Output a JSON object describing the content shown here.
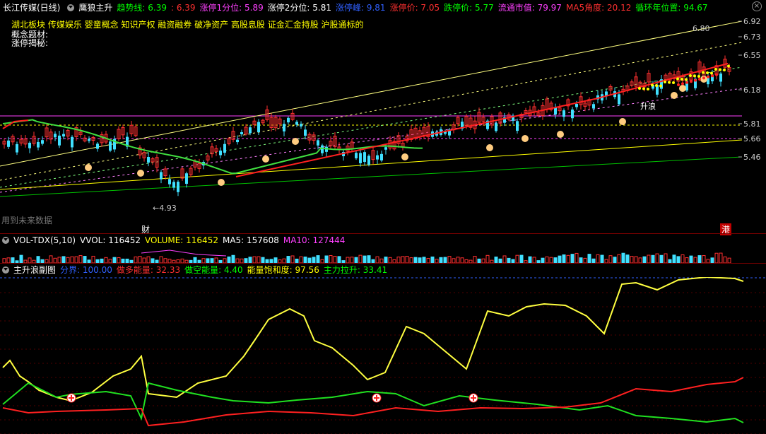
{
  "main_header": {
    "stock": "长江传媒(日线)",
    "indicator": "鹰狼主升",
    "items": [
      {
        "label": "趋势线: 6.39",
        "color": "#00ff00"
      },
      {
        "label": ": 6.39",
        "color": "#ff3030"
      },
      {
        "label": "涨停1分位: 5.89",
        "color": "#ff40ff"
      },
      {
        "label": "涨停2分位: 5.81",
        "color": "#ffffff"
      },
      {
        "label": "涨停峰: 9.81",
        "color": "#3060ff"
      },
      {
        "label": "涨停价: 7.05",
        "color": "#ff3030"
      },
      {
        "label": "跌停价: 5.77",
        "color": "#00ff00"
      },
      {
        "label": "流通市值: 79.97",
        "color": "#ff40ff"
      },
      {
        "label": "MA5角度: 20.12",
        "color": "#ff3030"
      },
      {
        "label": "循环年位置: 94.67",
        "color": "#00ff00"
      }
    ]
  },
  "concepts": "湖北板块 传媒娱乐 婴童概念 知识产权 融资融券 破净资产 高股息股 证金汇金持股 沪股通标的",
  "theme_label": "概念题材:",
  "limit_label": "涨停揭秘:",
  "future_label": "用到未来数据",
  "fin_badge": "财",
  "hk_badge": "港",
  "price_labels": [
    "6.92",
    "6.73",
    "6.55",
    "6.18",
    "5.81",
    "5.66",
    "5.46"
  ],
  "high_label": "6.80",
  "low_label": "4.93",
  "vol_header": {
    "name": "VOL-TDX(5,10)",
    "items": [
      {
        "label": "VVOL: 116452",
        "color": "#ffffff"
      },
      {
        "label": "VOLUME: 116452",
        "color": "#ffff00"
      },
      {
        "label": "MA5: 157608",
        "color": "#ffffff"
      },
      {
        "label": "MA10: 127444",
        "color": "#ff40ff"
      }
    ]
  },
  "sub_header": {
    "name": "主升浪副图",
    "items": [
      {
        "label": "分界: 100.00",
        "color": "#3060ff"
      },
      {
        "label": "做多能量: 32.33",
        "color": "#ff3030"
      },
      {
        "label": "做空能量: 4.40",
        "color": "#00ff00"
      },
      {
        "label": "能量饱和度: 97.56",
        "color": "#ffff00"
      },
      {
        "label": "主力拉升: 33.41",
        "color": "#00ff00"
      }
    ]
  },
  "annotations": [
    "升浪"
  ]
}
